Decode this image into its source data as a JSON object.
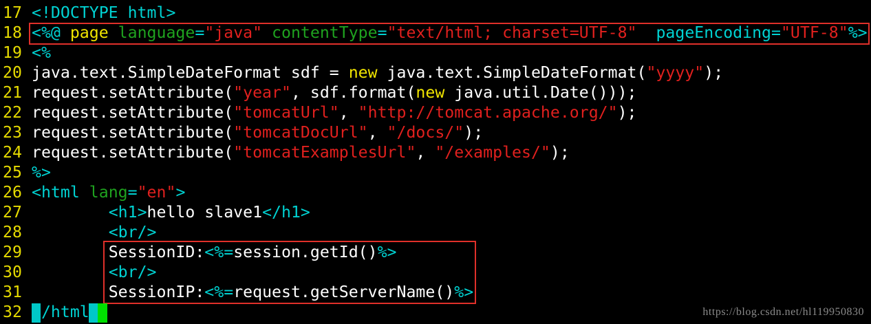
{
  "editor": {
    "lines": [
      {
        "num": "17",
        "tokens": [
          {
            "t": "<!DOCTYPE html>",
            "c": "cyan"
          }
        ]
      },
      {
        "num": "18",
        "tokens": [
          {
            "t": "<%@ ",
            "c": "cyan"
          },
          {
            "t": "page",
            "c": "yellow"
          },
          {
            "t": " ",
            "c": "white"
          },
          {
            "t": "language",
            "c": "green"
          },
          {
            "t": "=",
            "c": "cyan"
          },
          {
            "t": "\"java\"",
            "c": "red"
          },
          {
            "t": " ",
            "c": "white"
          },
          {
            "t": "contentType",
            "c": "green"
          },
          {
            "t": "=",
            "c": "cyan"
          },
          {
            "t": "\"text/html; charset=UTF-8\"",
            "c": "red"
          },
          {
            "t": "  ",
            "c": "white"
          },
          {
            "t": "pageEncoding",
            "c": "cyan"
          },
          {
            "t": "=",
            "c": "cyan"
          },
          {
            "t": "\"UTF-8\"",
            "c": "red"
          },
          {
            "t": "%>",
            "c": "cyan"
          }
        ]
      },
      {
        "num": "19",
        "tokens": [
          {
            "t": "<%",
            "c": "cyan"
          }
        ]
      },
      {
        "num": "20",
        "tokens": [
          {
            "t": "java.text.SimpleDateFormat sdf = ",
            "c": "white"
          },
          {
            "t": "new",
            "c": "yellow"
          },
          {
            "t": " java.text.SimpleDateFormat(",
            "c": "white"
          },
          {
            "t": "\"yyyy\"",
            "c": "red"
          },
          {
            "t": ");",
            "c": "white"
          }
        ]
      },
      {
        "num": "21",
        "tokens": [
          {
            "t": "request.setAttribute(",
            "c": "white"
          },
          {
            "t": "\"year\"",
            "c": "red"
          },
          {
            "t": ", sdf.format(",
            "c": "white"
          },
          {
            "t": "new",
            "c": "yellow"
          },
          {
            "t": " java.util.Date()));",
            "c": "white"
          }
        ]
      },
      {
        "num": "22",
        "tokens": [
          {
            "t": "request.setAttribute(",
            "c": "white"
          },
          {
            "t": "\"tomcatUrl\"",
            "c": "red"
          },
          {
            "t": ", ",
            "c": "white"
          },
          {
            "t": "\"http://tomcat.apache.org/\"",
            "c": "red"
          },
          {
            "t": ");",
            "c": "white"
          }
        ]
      },
      {
        "num": "23",
        "tokens": [
          {
            "t": "request.setAttribute(",
            "c": "white"
          },
          {
            "t": "\"tomcatDocUrl\"",
            "c": "red"
          },
          {
            "t": ", ",
            "c": "white"
          },
          {
            "t": "\"/docs/\"",
            "c": "red"
          },
          {
            "t": ");",
            "c": "white"
          }
        ]
      },
      {
        "num": "24",
        "tokens": [
          {
            "t": "request.setAttribute(",
            "c": "white"
          },
          {
            "t": "\"tomcatExamplesUrl\"",
            "c": "red"
          },
          {
            "t": ", ",
            "c": "white"
          },
          {
            "t": "\"/examples/\"",
            "c": "red"
          },
          {
            "t": ");",
            "c": "white"
          }
        ]
      },
      {
        "num": "25",
        "tokens": [
          {
            "t": "%>",
            "c": "cyan"
          }
        ]
      },
      {
        "num": "26",
        "tokens": [
          {
            "t": "<html",
            "c": "cyan"
          },
          {
            "t": " ",
            "c": "white"
          },
          {
            "t": "lang",
            "c": "green"
          },
          {
            "t": "=",
            "c": "cyan"
          },
          {
            "t": "\"en\"",
            "c": "red"
          },
          {
            "t": ">",
            "c": "cyan"
          }
        ]
      },
      {
        "num": "27",
        "tokens": [
          {
            "t": "        ",
            "c": "white"
          },
          {
            "t": "<h1>",
            "c": "cyan"
          },
          {
            "t": "hello slave1",
            "c": "white"
          },
          {
            "t": "</h1>",
            "c": "cyan"
          }
        ]
      },
      {
        "num": "28",
        "tokens": [
          {
            "t": "        ",
            "c": "white"
          },
          {
            "t": "<br/>",
            "c": "cyan"
          }
        ]
      },
      {
        "num": "29",
        "tokens": [
          {
            "t": "        ",
            "c": "white"
          },
          {
            "t": "SessionID:",
            "c": "white"
          },
          {
            "t": "<%=",
            "c": "cyan"
          },
          {
            "t": "session.getId()",
            "c": "white"
          },
          {
            "t": "%>",
            "c": "cyan"
          }
        ]
      },
      {
        "num": "30",
        "tokens": [
          {
            "t": "        ",
            "c": "white"
          },
          {
            "t": "<br/>",
            "c": "cyan"
          }
        ]
      },
      {
        "num": "31",
        "tokens": [
          {
            "t": "        ",
            "c": "white"
          },
          {
            "t": "SessionIP:",
            "c": "white"
          },
          {
            "t": "<%=",
            "c": "cyan"
          },
          {
            "t": "request.getServerName()",
            "c": "white"
          },
          {
            "t": "%>",
            "c": "cyan"
          }
        ]
      },
      {
        "num": "32",
        "tokens": [
          {
            "t": " ",
            "c": "white"
          },
          {
            "t": "/html",
            "c": "cyan"
          }
        ]
      }
    ]
  },
  "colors": {
    "background": "#000000",
    "line_number": "#e6db00",
    "highlight_border": "#e0302a",
    "cursor": "#00c8c8",
    "cursor_alt": "#00e000"
  },
  "watermark": {
    "text": "https://blog.csdn.net/hl119950830"
  }
}
